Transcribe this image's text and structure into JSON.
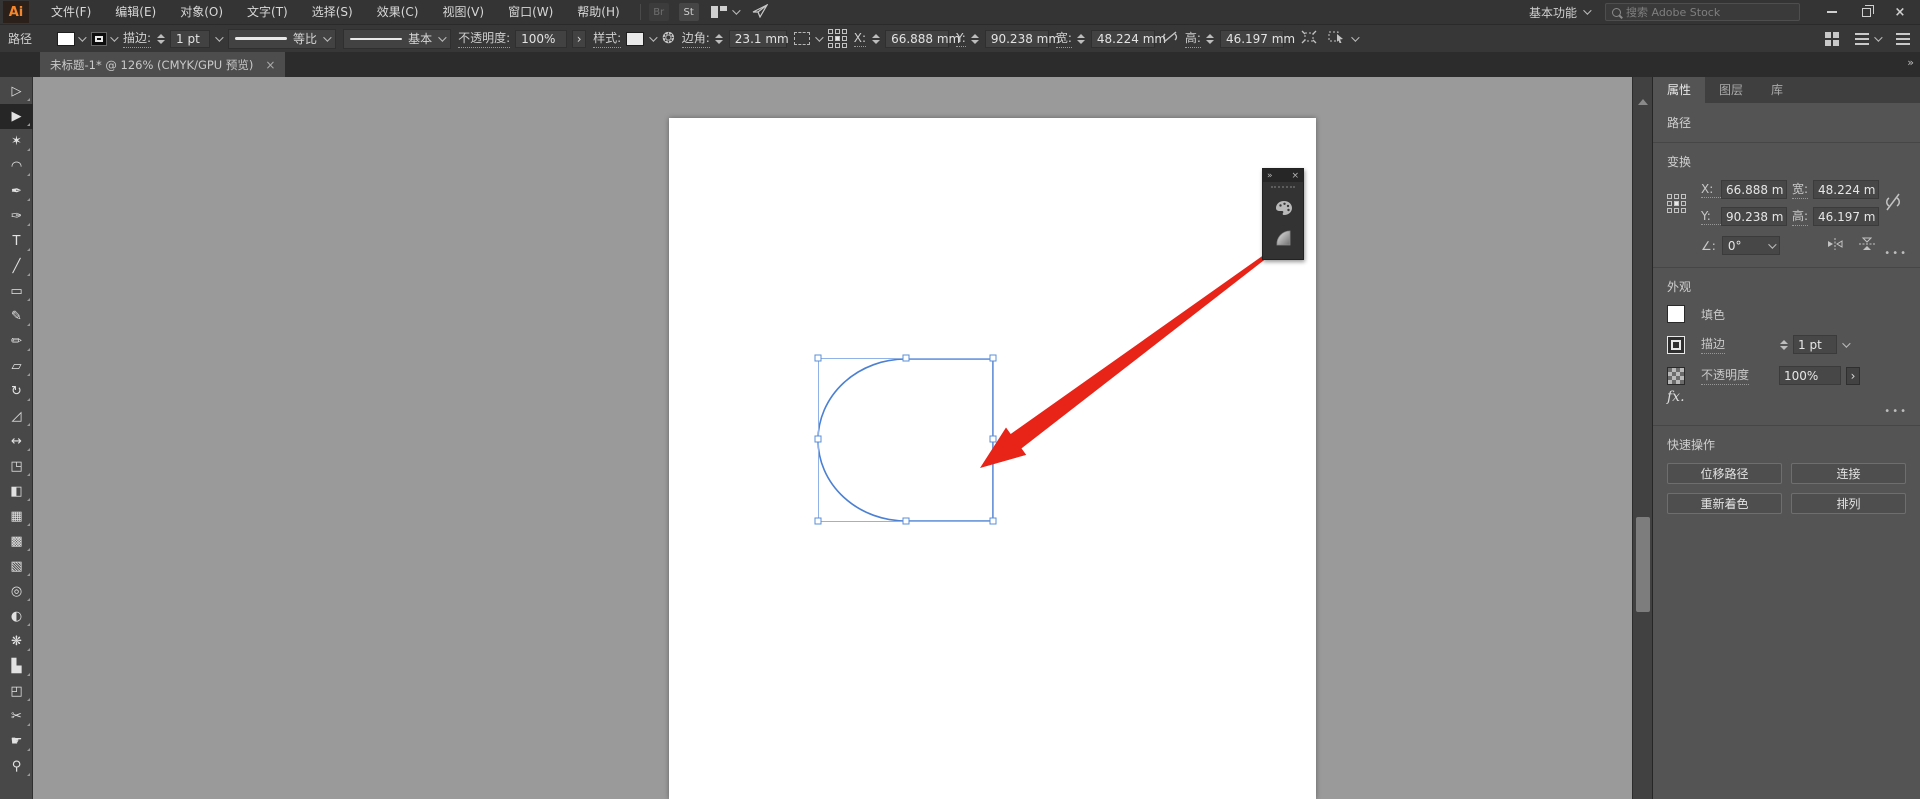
{
  "app": {
    "logo": "Ai"
  },
  "menubar": {
    "items": [
      {
        "name": "menu-file",
        "label": "文件(F)"
      },
      {
        "name": "menu-edit",
        "label": "编辑(E)"
      },
      {
        "name": "menu-object",
        "label": "对象(O)"
      },
      {
        "name": "menu-type",
        "label": "文字(T)"
      },
      {
        "name": "menu-select",
        "label": "选择(S)"
      },
      {
        "name": "menu-effect",
        "label": "效果(C)"
      },
      {
        "name": "menu-view",
        "label": "视图(V)"
      },
      {
        "name": "menu-window",
        "label": "窗口(W)"
      },
      {
        "name": "menu-help",
        "label": "帮助(H)"
      }
    ],
    "bridge_badge": "Br",
    "stock_badge": "St",
    "workspace": "基本功能",
    "search_placeholder": "搜索 Adobe Stock"
  },
  "controlbar": {
    "selection_type": "路径",
    "stroke_label": "描边:",
    "stroke_weight": "1 pt",
    "variable_width_profile": "等比",
    "brush_definition": "基本",
    "opacity_label": "不透明度:",
    "opacity_value": "100%",
    "opacity_more": "›",
    "style_label": "样式:",
    "corner_label": "边角:",
    "corner_value": "23.1 mm",
    "x_label": "X:",
    "x_value": "66.888 mm",
    "y_label": "Y:",
    "y_value": "90.238 mm",
    "w_label": "宽:",
    "w_value": "48.224 mm",
    "h_label": "高:",
    "h_value": "46.197 mm"
  },
  "document_tab": {
    "title": "未标题-1* @ 126% (CMYK/GPU 预览)",
    "close_glyph": "×"
  },
  "toolbar": {
    "collapse_glyph": "»",
    "tools": [
      {
        "name": "selection-tool",
        "glyph": "▷"
      },
      {
        "name": "direct-selection-tool",
        "glyph": "▶",
        "active": true
      },
      {
        "name": "magic-wand-tool",
        "glyph": "✶"
      },
      {
        "name": "lasso-tool",
        "glyph": "◠"
      },
      {
        "name": "pen-tool",
        "glyph": "✒"
      },
      {
        "name": "curvature-tool",
        "glyph": "✑"
      },
      {
        "name": "type-tool",
        "glyph": "T"
      },
      {
        "name": "line-segment-tool",
        "glyph": "╱"
      },
      {
        "name": "rectangle-tool",
        "glyph": "▭"
      },
      {
        "name": "paintbrush-tool",
        "glyph": "✎"
      },
      {
        "name": "shaper-tool",
        "glyph": "✏"
      },
      {
        "name": "eraser-tool",
        "glyph": "▱"
      },
      {
        "name": "rotate-tool",
        "glyph": "↻"
      },
      {
        "name": "scale-tool",
        "glyph": "◿"
      },
      {
        "name": "width-tool",
        "glyph": "↔"
      },
      {
        "name": "free-transform-tool",
        "glyph": "◳"
      },
      {
        "name": "shape-builder-tool",
        "glyph": "◧"
      },
      {
        "name": "perspective-grid-tool",
        "glyph": "▦"
      },
      {
        "name": "mesh-tool",
        "glyph": "▩"
      },
      {
        "name": "gradient-tool",
        "glyph": "▧"
      },
      {
        "name": "eyedropper-tool",
        "glyph": "◎"
      },
      {
        "name": "blend-tool",
        "glyph": "◐"
      },
      {
        "name": "symbol-sprayer-tool",
        "glyph": "❋"
      },
      {
        "name": "column-graph-tool",
        "glyph": "▙"
      },
      {
        "name": "artboard-tool",
        "glyph": "◰"
      },
      {
        "name": "slice-tool",
        "glyph": "✂"
      },
      {
        "name": "hand-tool",
        "glyph": "☛"
      },
      {
        "name": "zoom-tool",
        "glyph": "⚲"
      }
    ]
  },
  "floating_panel": {
    "collapse_glyph": "»",
    "close_glyph": "×"
  },
  "panel": {
    "collapse_glyph": "»",
    "tabs": [
      {
        "name": "tab-properties",
        "label": "属性",
        "active": true
      },
      {
        "name": "tab-layers",
        "label": "图层"
      },
      {
        "name": "tab-libraries",
        "label": "库"
      }
    ],
    "selection_type": "路径",
    "transform": {
      "title": "变换",
      "x_label": "X:",
      "x_value": "66.888 m",
      "y_label": "Y:",
      "y_value": "90.238 m",
      "w_label": "宽:",
      "w_value": "48.224 m",
      "h_label": "高:",
      "h_value": "46.197 m",
      "angle_label": "∠:",
      "angle_value": "0°",
      "more_glyph": "•••"
    },
    "appearance": {
      "title": "外观",
      "fill_label": "填色",
      "stroke_label": "描边",
      "stroke_weight": "1 pt",
      "opacity_label": "不透明度",
      "opacity_value": "100%",
      "opacity_more": "›",
      "fx_label": "fx.",
      "more_glyph": "•••"
    },
    "quick_actions": {
      "title": "快速操作",
      "buttons": [
        {
          "name": "offset-path-button",
          "label": "位移路径"
        },
        {
          "name": "join-button",
          "label": "连接"
        },
        {
          "name": "recolor-button",
          "label": "重新着色"
        },
        {
          "name": "arrange-button",
          "label": "排列"
        }
      ]
    }
  },
  "colors": {
    "selection_blue": "#4c80d2",
    "handle_stroke": "#5b8ed8",
    "arrow_red": "#e82318",
    "logo_orange": "#f5862b",
    "pasteboard": "#9a9a9a",
    "artboard": "#ffffff"
  }
}
